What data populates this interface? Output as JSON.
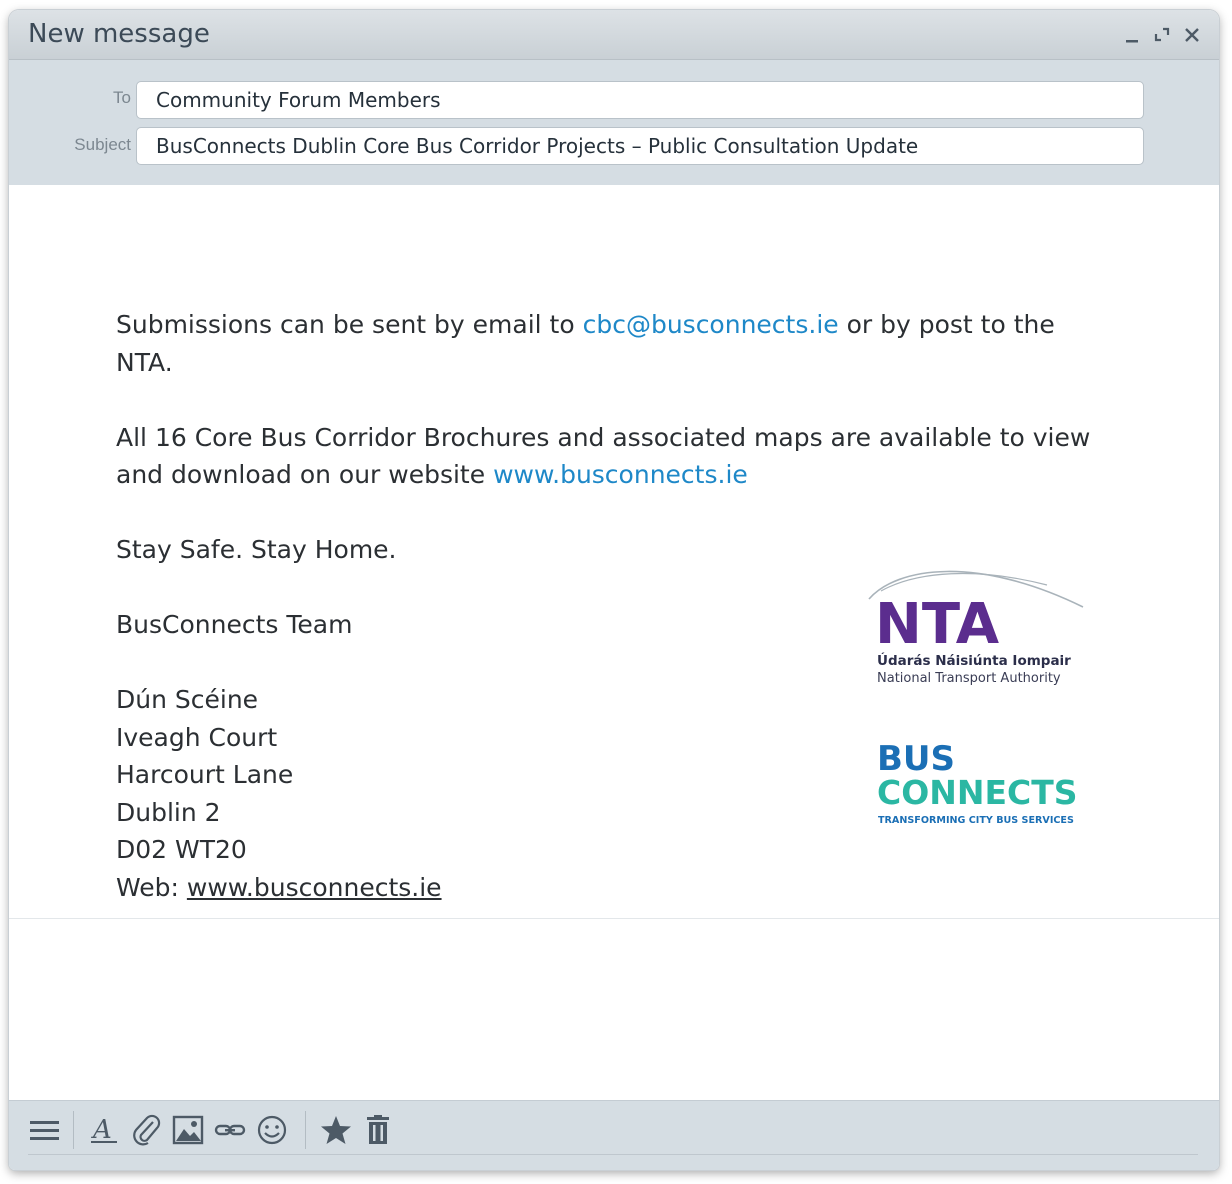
{
  "window": {
    "title": "New message"
  },
  "headers": {
    "to_label": "To",
    "to_value": "Community Forum Members",
    "subject_label": "Subject",
    "subject_value": "BusConnects Dublin Core Bus Corridor Projects – Public Consultation Update"
  },
  "body": {
    "p1_before": "Submissions can be sent by email to ",
    "p1_link": "cbc@busconnects.ie",
    "p1_after": " or by post to the NTA.",
    "p2_before": "All 16 Core Bus Corridor Brochures and associated maps are available to view and download on our website ",
    "p2_link": "www.busconnects.ie",
    "p3": "Stay Safe. Stay Home.",
    "p4": "BusConnects Team",
    "address": [
      "Dún Scéine",
      "Iveagh Court",
      "Harcourt Lane",
      "Dublin 2",
      "D02 WT20"
    ],
    "web_label": "Web: ",
    "web_link": "www.busconnects.ie"
  },
  "nta_logo": {
    "wordmark": "NTA",
    "irish_name": "Údarás Náisiúnta Iompair",
    "english_name": "National Transport Authority"
  },
  "busconnects_logo": {
    "line1": "BUS",
    "line2": "CONNECTS",
    "tagline": "TRANSFORMING CITY BUS SERVICES"
  },
  "colors": {
    "link": "#1e88c8",
    "nta_purple": "#5b2d8e",
    "busconnects_blue": "#1b6fb5",
    "busconnects_green": "#2bb7a3",
    "header_bg": "#d5dde3"
  },
  "toolbar": {
    "icons": [
      "menu-icon",
      "text-format-icon",
      "attachment-icon",
      "image-icon",
      "link-icon",
      "emoji-icon",
      "star-icon",
      "trash-icon"
    ]
  }
}
